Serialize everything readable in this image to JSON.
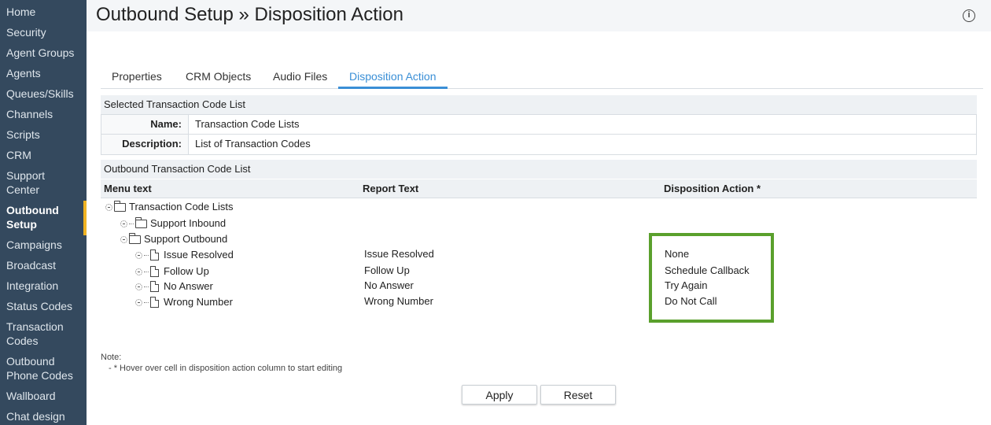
{
  "sidebar": {
    "items": [
      {
        "label": "Home"
      },
      {
        "label": "Security"
      },
      {
        "label": "Agent Groups"
      },
      {
        "label": "Agents"
      },
      {
        "label": "Queues/Skills"
      },
      {
        "label": "Channels"
      },
      {
        "label": "Scripts"
      },
      {
        "label": "CRM"
      },
      {
        "label": "Support Center"
      },
      {
        "label": "Outbound Setup"
      },
      {
        "label": "Campaigns"
      },
      {
        "label": "Broadcast"
      },
      {
        "label": "Integration"
      },
      {
        "label": "Status Codes"
      },
      {
        "label": "Transaction Codes"
      },
      {
        "label": "Outbound Phone Codes"
      },
      {
        "label": "Wallboard"
      },
      {
        "label": "Chat design"
      }
    ],
    "active_item": "Outbound Setup",
    "active_accent": "#f0b323"
  },
  "header": {
    "title": "Outbound Setup » Disposition Action",
    "info_icon": "info-icon"
  },
  "tabs": [
    {
      "label": "Properties"
    },
    {
      "label": "CRM Objects"
    },
    {
      "label": "Audio Files"
    },
    {
      "label": "Disposition Action"
    }
  ],
  "active_tab": "Disposition Action",
  "selected_list": {
    "heading": "Selected Transaction Code List",
    "name_label": "Name:",
    "name_value": "Transaction Code Lists",
    "description_label": "Description:",
    "description_value": "List of Transaction Codes"
  },
  "outbound_list": {
    "heading": "Outbound Transaction Code List",
    "columns": {
      "menu_text": "Menu text",
      "report_text": "Report Text",
      "disposition_action": "Disposition Action *"
    },
    "tree": {
      "root": "Transaction Code Lists",
      "folders": [
        "Support Inbound",
        "Support Outbound"
      ]
    },
    "rows": [
      {
        "menu_text": "Issue Resolved",
        "report_text": "Issue Resolved",
        "disposition_action": "None"
      },
      {
        "menu_text": "Follow Up",
        "report_text": "Follow Up",
        "disposition_action": "Schedule Callback"
      },
      {
        "menu_text": "No Answer",
        "report_text": "No Answer",
        "disposition_action": "Try Again"
      },
      {
        "menu_text": "Wrong Number",
        "report_text": "Wrong Number",
        "disposition_action": "Do Not Call"
      }
    ],
    "highlight_color": "#5aa02c"
  },
  "note": {
    "title": "Note:",
    "text": "- * Hover over cell in disposition action column to start editing"
  },
  "buttons": {
    "apply": "Apply",
    "reset": "Reset"
  },
  "colors": {
    "sidebar_bg": "#34495e",
    "tab_active": "#3a8fd6"
  }
}
